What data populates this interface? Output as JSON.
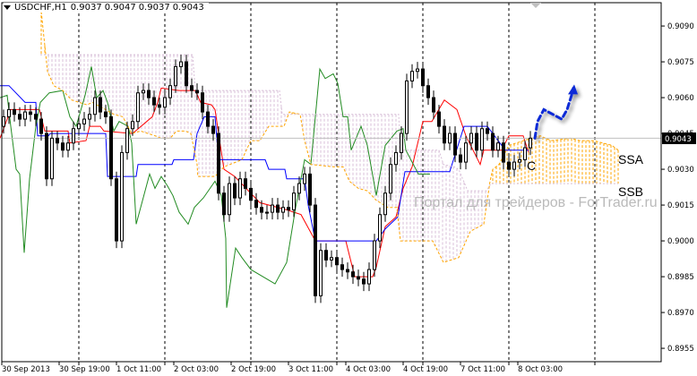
{
  "header": {
    "symbol": "USDCHF,H1",
    "open": "0.9037",
    "high": "0.9047",
    "low": "0.9037",
    "close": "0.9043"
  },
  "colors": {
    "tenkan": "#FF0000",
    "kijun": "#0000FF",
    "chikou": "#228B22",
    "senkou_a": "#FFA500",
    "senkou_b": "#D8BFD8",
    "bull_body": "#FFFFFF",
    "bear_body": "#000000",
    "arrow": "#0A2BD6",
    "current_price_line": "#C0C0C0"
  },
  "annotations": {
    "wave_label": "C",
    "ssa_label": "SSA",
    "ssb_label": "SSB",
    "watermark": "Портал для трейдеров - ForTrader.ru"
  },
  "chart_data": {
    "type": "candlestick",
    "title": "USDCHF,H1",
    "x_unit": "hours (H1 bars) from 30 Sep 2013 00:00",
    "ylim": [
      0.8945,
      0.91
    ],
    "y_ticks": [
      "0.9090",
      "0.9075",
      "0.9060",
      "0.9045",
      "0.9030",
      "0.9015",
      "0.9000",
      "0.8985",
      "0.8970",
      "0.8955"
    ],
    "current_price": "0.9043",
    "x_ticks": [
      {
        "hour": 0,
        "label": "30 Sep 2013"
      },
      {
        "hour": 16,
        "label": "30 Sep 19:00"
      },
      {
        "hour": 32,
        "label": "1 Oct 11:00"
      },
      {
        "hour": 48,
        "label": "2 Oct 03:00"
      },
      {
        "hour": 64,
        "label": "2 Oct 19:00"
      },
      {
        "hour": 80,
        "label": "3 Oct 11:00"
      },
      {
        "hour": 96,
        "label": "4 Oct 03:00"
      },
      {
        "hour": 112,
        "label": "4 Oct 19:00"
      },
      {
        "hour": 128,
        "label": "7 Oct 11:00"
      },
      {
        "hour": 144,
        "label": "8 Oct 03:00"
      }
    ],
    "grid_hours": [
      22,
      46,
      70,
      94,
      118,
      142,
      166
    ],
    "candles": {
      "first_hour": 1,
      "hour_step": 1.5,
      "first_open": 0.9048,
      "close": [
        0.9052,
        0.9055,
        0.9053,
        0.9051,
        0.9054,
        0.9053,
        0.9051,
        0.9045,
        0.9026,
        0.9043,
        0.9041,
        0.9038,
        0.9041,
        0.9047,
        0.9049,
        0.9051,
        0.9053,
        0.906,
        0.9054,
        0.9052,
        0.9026,
        0.9,
        0.9037,
        0.9047,
        0.905,
        0.9062,
        0.9063,
        0.906,
        0.9057,
        0.9056,
        0.906,
        0.9065,
        0.9073,
        0.9075,
        0.9065,
        0.9063,
        0.9062,
        0.9054,
        0.9048,
        0.9045,
        0.902,
        0.9011,
        0.9024,
        0.9018,
        0.9026,
        0.9022,
        0.9017,
        0.9014,
        0.9012,
        0.9012,
        0.9015,
        0.9012,
        0.9014,
        0.9013,
        0.902,
        0.9024,
        0.9028,
        0.9015,
        0.8977,
        0.8996,
        0.8992,
        0.8993,
        0.899,
        0.8988,
        0.8987,
        0.8985,
        0.8984,
        0.8982,
        0.8988,
        0.9,
        0.9011,
        0.902,
        0.9032,
        0.9037,
        0.9045,
        0.9067,
        0.9071,
        0.9072,
        0.9065,
        0.906,
        0.9054,
        0.9048,
        0.9041,
        0.9045,
        0.9036,
        0.9033,
        0.9041,
        0.9045,
        0.9038,
        0.9047,
        0.9045,
        0.9038,
        0.9041,
        0.9033,
        0.903,
        0.9033,
        0.9034,
        0.9039,
        0.9043
      ]
    },
    "series": [
      {
        "name": "Tenkan-sen",
        "key": "tenkan",
        "points": [
          [
            0,
            0.9043
          ],
          [
            3,
            0.9055
          ],
          [
            11,
            0.9055
          ],
          [
            12.5,
            0.9046
          ],
          [
            19,
            0.9046
          ],
          [
            19.5,
            0.9041
          ],
          [
            24,
            0.9042
          ],
          [
            25,
            0.9048
          ],
          [
            28,
            0.9048
          ],
          [
            29,
            0.9046
          ],
          [
            37,
            0.9045
          ],
          [
            42.5,
            0.9052
          ],
          [
            44,
            0.9058
          ],
          [
            45,
            0.9064
          ],
          [
            50,
            0.9063
          ],
          [
            54.5,
            0.9063
          ],
          [
            56,
            0.9058
          ],
          [
            59,
            0.9057
          ],
          [
            60,
            0.9055
          ],
          [
            62.5,
            0.903
          ],
          [
            65.5,
            0.9027
          ],
          [
            72.5,
            0.9016
          ],
          [
            80,
            0.9013
          ],
          [
            84,
            0.9011
          ],
          [
            88,
            0.9
          ],
          [
            96.5,
            0.9
          ],
          [
            99,
            0.8985
          ],
          [
            104,
            0.8985
          ],
          [
            105,
            0.8989
          ],
          [
            107.5,
            0.9006
          ],
          [
            110.5,
            0.901
          ],
          [
            112.5,
            0.9022
          ],
          [
            115,
            0.9031
          ],
          [
            118,
            0.905
          ],
          [
            120.5,
            0.905
          ],
          [
            124,
            0.9059
          ],
          [
            127.5,
            0.9055
          ],
          [
            130,
            0.9044
          ],
          [
            134,
            0.9032
          ],
          [
            135,
            0.9038
          ],
          [
            140,
            0.9038
          ],
          [
            142,
            0.9044
          ],
          [
            146,
            0.9044
          ],
          [
            147.5,
            0.9037
          ]
        ]
      },
      {
        "name": "Kijun-sen",
        "key": "kijun",
        "points": [
          [
            0,
            0.9065
          ],
          [
            2.5,
            0.9065
          ],
          [
            7,
            0.9058
          ],
          [
            10,
            0.9058
          ],
          [
            10.5,
            0.9044
          ],
          [
            13.5,
            0.9044
          ],
          [
            14,
            0.9045
          ],
          [
            29.5,
            0.9045
          ],
          [
            30,
            0.9027
          ],
          [
            38,
            0.9027
          ],
          [
            38.5,
            0.9032
          ],
          [
            48,
            0.9032
          ],
          [
            48.5,
            0.9034
          ],
          [
            54,
            0.9034
          ],
          [
            55,
            0.9045
          ],
          [
            57,
            0.9052
          ],
          [
            60,
            0.9052
          ],
          [
            61,
            0.9034
          ],
          [
            74,
            0.9034
          ],
          [
            75,
            0.903
          ],
          [
            79.5,
            0.903
          ],
          [
            80,
            0.9026
          ],
          [
            85,
            0.9026
          ],
          [
            86,
            0.9015
          ],
          [
            88,
            0.9
          ],
          [
            105,
            0.9
          ],
          [
            107.5,
            0.9005
          ],
          [
            111,
            0.901
          ],
          [
            113,
            0.9029
          ],
          [
            125.5,
            0.9029
          ],
          [
            129.5,
            0.9048
          ],
          [
            136,
            0.9048
          ],
          [
            141,
            0.9038
          ],
          [
            147.5,
            0.9038
          ]
        ]
      },
      {
        "name": "Chikou Span",
        "key": "chikou",
        "points": [
          [
            0,
            0.906
          ],
          [
            2,
            0.9061
          ],
          [
            3,
            0.9048
          ],
          [
            4.5,
            0.903
          ],
          [
            5.5,
            0.9028
          ],
          [
            6.75,
            0.8995
          ],
          [
            8.25,
            0.9026
          ],
          [
            10,
            0.9048
          ],
          [
            11.25,
            0.9058
          ],
          [
            13.75,
            0.9062
          ],
          [
            17.5,
            0.9063
          ],
          [
            19.5,
            0.9052
          ],
          [
            21.25,
            0.9048
          ],
          [
            23.75,
            0.9061
          ],
          [
            25.5,
            0.9073
          ],
          [
            27,
            0.906
          ],
          [
            28.75,
            0.9063
          ],
          [
            30,
            0.9058
          ],
          [
            31.75,
            0.9046
          ],
          [
            33.25,
            0.905
          ],
          [
            35.75,
            0.9048
          ],
          [
            36.75,
            0.9041
          ],
          [
            38,
            0.9007
          ],
          [
            39.25,
            0.9014
          ],
          [
            41.75,
            0.9028
          ],
          [
            43.25,
            0.9022
          ],
          [
            45,
            0.9027
          ],
          [
            46.75,
            0.9023
          ],
          [
            48.25,
            0.9019
          ],
          [
            50,
            0.9012
          ],
          [
            52.5,
            0.9007
          ],
          [
            54.25,
            0.9014
          ],
          [
            56.75,
            0.9018
          ],
          [
            60,
            0.9025
          ],
          [
            61.75,
            0.9019
          ],
          [
            63,
            0.9001
          ],
          [
            63.25,
            0.8972
          ],
          [
            65.75,
            0.8997
          ],
          [
            67.5,
            0.8993
          ],
          [
            70,
            0.8988
          ],
          [
            76.75,
            0.8982
          ],
          [
            80,
            0.8991
          ],
          [
            82.5,
            0.9014
          ],
          [
            85,
            0.9034
          ],
          [
            86.75,
            0.9032
          ],
          [
            89.25,
            0.9072
          ],
          [
            90.75,
            0.9068
          ],
          [
            93,
            0.907
          ],
          [
            94.25,
            0.9066
          ],
          [
            95.75,
            0.9052
          ],
          [
            97,
            0.9052
          ],
          [
            98,
            0.9038
          ],
          [
            100.75,
            0.9048
          ],
          [
            102.5,
            0.904
          ],
          [
            105,
            0.9019
          ],
          [
            107.5,
            0.904
          ],
          [
            110.75,
            0.9046
          ],
          [
            112.5,
            0.9047
          ],
          [
            113.25,
            0.9038
          ],
          [
            116.75,
            0.9028
          ],
          [
            120,
            0.9028
          ]
        ]
      },
      {
        "name": "Senkou Span A",
        "key": "senkou_a",
        "points": [
          [
            11.25,
            0.91
          ],
          [
            13.25,
            0.9071
          ],
          [
            15,
            0.9065
          ],
          [
            17.5,
            0.9063
          ],
          [
            20,
            0.9059
          ],
          [
            24.25,
            0.9057
          ],
          [
            25.75,
            0.9058
          ],
          [
            28.25,
            0.9056
          ],
          [
            31.75,
            0.9053
          ],
          [
            34.25,
            0.9052
          ],
          [
            36.75,
            0.9045
          ],
          [
            39.25,
            0.9046
          ],
          [
            43.25,
            0.9044
          ],
          [
            45,
            0.9043
          ],
          [
            47.5,
            0.9043
          ],
          [
            49.25,
            0.9046
          ],
          [
            51.75,
            0.9046
          ],
          [
            53.25,
            0.9045
          ],
          [
            55,
            0.9032
          ],
          [
            55.2,
            0.9027
          ],
          [
            60,
            0.9027
          ],
          [
            62.5,
            0.9031
          ],
          [
            67.5,
            0.9034
          ],
          [
            70,
            0.9042
          ],
          [
            72.5,
            0.9042
          ],
          [
            75,
            0.9048
          ],
          [
            79.25,
            0.9048
          ],
          [
            80.75,
            0.9054
          ],
          [
            83.75,
            0.9053
          ],
          [
            85,
            0.9042
          ],
          [
            86.75,
            0.9032
          ],
          [
            93.25,
            0.9031
          ],
          [
            95.75,
            0.9031
          ],
          [
            97.5,
            0.9025
          ],
          [
            100,
            0.9022
          ],
          [
            102.5,
            0.9021
          ],
          [
            105,
            0.9017
          ],
          [
            108.25,
            0.9014
          ],
          [
            110.75,
            0.9014
          ],
          [
            111.75,
            0.9
          ],
          [
            120.75,
            0.9
          ],
          [
            123.75,
            0.8991
          ],
          [
            128,
            0.8993
          ],
          [
            131.25,
            0.9004
          ],
          [
            135,
            0.9007
          ],
          [
            136.75,
            0.9025
          ],
          [
            137.5,
            0.903
          ],
          [
            139.25,
            0.9032
          ],
          [
            142,
            0.904
          ],
          [
            148.25,
            0.9043
          ],
          [
            150.75,
            0.9044
          ],
          [
            153.75,
            0.9042
          ],
          [
            159.25,
            0.9043
          ],
          [
            161.75,
            0.9042
          ],
          [
            165.75,
            0.9042
          ],
          [
            170.75,
            0.904
          ],
          [
            172.5,
            0.9038
          ]
        ]
      },
      {
        "name": "Senkou Span B",
        "key": "senkou_b",
        "points": [
          [
            11.25,
            0.9078
          ],
          [
            53.75,
            0.9078
          ],
          [
            54.5,
            0.9063
          ],
          [
            78,
            0.9063
          ],
          [
            78.75,
            0.9053
          ],
          [
            111.25,
            0.9053
          ],
          [
            111.75,
            0.9038
          ],
          [
            122.5,
            0.9038
          ],
          [
            123.75,
            0.9032
          ],
          [
            126.75,
            0.9031
          ],
          [
            128,
            0.903
          ],
          [
            130.5,
            0.9021
          ],
          [
            135.75,
            0.9021
          ],
          [
            137,
            0.9024
          ],
          [
            172.5,
            0.9024
          ]
        ]
      }
    ],
    "forecast_arrow": {
      "points": [
        [
          149.25,
          0.9043
        ],
        [
          150,
          0.905
        ],
        [
          151.75,
          0.9055
        ],
        [
          154.25,
          0.9053
        ],
        [
          156.75,
          0.9051
        ],
        [
          158.25,
          0.9055
        ],
        [
          159.5,
          0.9061
        ],
        [
          160,
          0.9064
        ]
      ]
    },
    "legend": "none",
    "grid": "vertical dashed"
  }
}
